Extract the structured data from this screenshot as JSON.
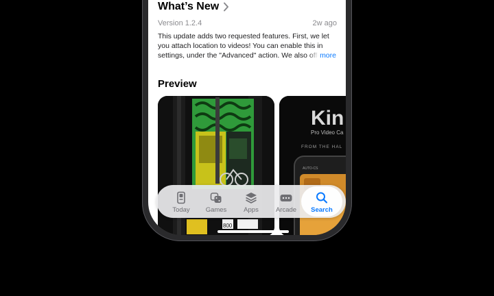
{
  "whats_new": {
    "title": "What’s New",
    "version": "Version 1.2.4",
    "age": "2w ago",
    "notes": "This update adds two requested features. First, we let you attach location to videos! You can enable this in settings, under the \"Advanced\" action. We also offer",
    "more_label": "more"
  },
  "preview": {
    "title": "Preview",
    "shot1": {
      "price_tag": "800"
    },
    "shot2": {
      "app_name": "Kin",
      "tagline": "Pro Video Ca",
      "from_text": "FROM THE HAL",
      "status_text": "AUTO-CS"
    }
  },
  "tabbar": {
    "active": "Search",
    "accent": "#0a7aff",
    "items": [
      {
        "label": "Today",
        "icon": "today-icon"
      },
      {
        "label": "Games",
        "icon": "games-icon"
      },
      {
        "label": "Apps",
        "icon": "apps-icon"
      },
      {
        "label": "Arcade",
        "icon": "arcade-icon"
      },
      {
        "label": "Search",
        "icon": "search-icon"
      }
    ]
  }
}
